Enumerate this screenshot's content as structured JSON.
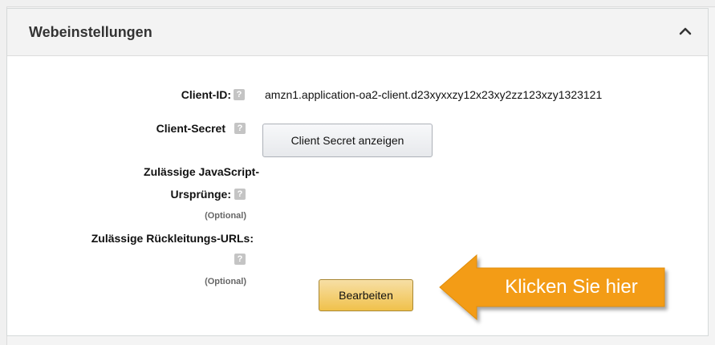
{
  "panel": {
    "title": "Webeinstellungen",
    "collapse_icon": "chevron-up-icon"
  },
  "fields": {
    "client_id": {
      "label": "Client-ID:",
      "value": "amzn1.application-oa2-client.d23xyxxzy12x23xy2zz123xzy1323121",
      "help_glyph": "?"
    },
    "client_secret": {
      "label": "Client-Secret",
      "button_label": "Client Secret anzeigen",
      "help_glyph": "?"
    },
    "js_origins": {
      "label_line1": "Zulässige JavaScript-",
      "label_line2": "Ursprünge:",
      "optional": "(Optional)",
      "help_glyph": "?"
    },
    "redirect_urls": {
      "label": "Zulässige Rückleitungs-URLs:",
      "optional": "(Optional)",
      "help_glyph": "?"
    }
  },
  "actions": {
    "edit_label": "Bearbeiten"
  },
  "callout": {
    "text": "Klicken Sie hier",
    "color": "#f39c12"
  },
  "colors": {
    "primary_button": "#f0c14b",
    "header_bg": "#f3f3f3"
  }
}
